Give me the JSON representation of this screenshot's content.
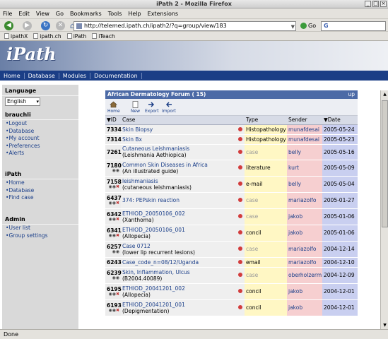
{
  "window": {
    "title": "iPath 2 - Mozilla Firefox"
  },
  "menu": [
    "File",
    "Edit",
    "View",
    "Go",
    "Bookmarks",
    "Tools",
    "Help",
    "Extensions"
  ],
  "address": {
    "url": "http://telemed.ipath.ch/ipath2/?q=group/view/183",
    "go_label": "Go",
    "search_value": "G"
  },
  "bookmarks": [
    "ipathX",
    "ipath.ch",
    "iPath",
    "iTeach"
  ],
  "site": {
    "logo": "iPath",
    "nav": [
      "Home",
      "Database",
      "Modules",
      "Documentation"
    ]
  },
  "sidebar": {
    "language_label": "Language",
    "language_value": "English",
    "user_heading": "brauchli",
    "user_items": [
      "Logout",
      "Database",
      "My account",
      "Preferences",
      "Alerts"
    ],
    "ipath_heading": "iPath",
    "ipath_items": [
      "Home",
      "Database",
      "Find case"
    ],
    "admin_heading": "Admin",
    "admin_items": [
      "User list",
      "Group settings"
    ]
  },
  "forum": {
    "title": "African Dermatology Forum ( 15)",
    "up_label": "up",
    "toolbar": [
      "Home",
      "New",
      "Export",
      "Import"
    ],
    "columns": [
      "ID",
      "Case",
      "Type",
      "Sender",
      "Date"
    ],
    "rows": [
      {
        "id": "7334",
        "case": "Skin Biopsy",
        "sub": "",
        "type": "Histopathology",
        "type_style": "normal",
        "sender": "munafdesai",
        "date": "2005-05-24",
        "icons": ""
      },
      {
        "id": "7314",
        "case": "Skin Bx",
        "sub": "",
        "type": "Histopathology",
        "type_style": "normal",
        "sender": "munafdesai",
        "date": "2005-05-23",
        "icons": ""
      },
      {
        "id": "7261",
        "case": "Cutaneous Leishmaniasis",
        "sub": "(Leishmania Aethiopica)",
        "type": "case",
        "type_style": "grey",
        "sender": "belly",
        "date": "2005-05-16",
        "icons": ""
      },
      {
        "id": "7180",
        "case": "Common Skin Diseases in Africa",
        "sub": "(An illustrated guide)",
        "type": "literature",
        "type_style": "normal",
        "sender": "kurt",
        "date": "2005-05-09",
        "icons": "spec"
      },
      {
        "id": "7158",
        "case": "leishmaniasis",
        "sub": "(cutaneous leishmaniasis)",
        "type": "e-mail",
        "type_style": "normal",
        "sender": "belly",
        "date": "2005-05-04",
        "icons": "specx"
      },
      {
        "id": "6437",
        "case": "374: PEPskin reaction",
        "sub": "",
        "type": "case",
        "type_style": "grey",
        "sender": "mariazolfo",
        "date": "2005-01-27",
        "icons": "specx"
      },
      {
        "id": "6342",
        "case": "ETHIOD_20050106_002",
        "sub": "(Xanthoma)",
        "type": "case",
        "type_style": "grey",
        "sender": "jakob",
        "date": "2005-01-06",
        "icons": "specx"
      },
      {
        "id": "6341",
        "case": "ETHIOD_20050106_001",
        "sub": "(Allopecia)",
        "type": "concil",
        "type_style": "normal",
        "sender": "jakob",
        "date": "2005-01-06",
        "icons": "specx"
      },
      {
        "id": "6257",
        "case": "Case 0712",
        "sub": "(lower lip recurrent lesions)",
        "type": "case",
        "type_style": "grey",
        "sender": "mariazolfo",
        "date": "2004-12-14",
        "icons": "spec"
      },
      {
        "id": "6243",
        "case": "Case_code_n=08/12/Uganda",
        "sub": "",
        "type": "email",
        "type_style": "normal",
        "sender": "mariazolfo",
        "date": "2004-12-10",
        "icons": ""
      },
      {
        "id": "6239",
        "case": "Skin, Inflammation, Ulcus",
        "sub": "(B2004.40089)",
        "type": "case",
        "type_style": "grey",
        "sender": "oberholzerm",
        "date": "2004-12-09",
        "icons": "spec"
      },
      {
        "id": "6195",
        "case": "ETHIOD_20041201_002",
        "sub": "(Allopecia)",
        "type": "concil",
        "type_style": "normal",
        "sender": "jakob",
        "date": "2004-12-01",
        "icons": "specx"
      },
      {
        "id": "6193",
        "case": "ETHIOD_20041201_001",
        "sub": "(Depigmentation)",
        "type": "concil",
        "type_style": "normal",
        "sender": "jakob",
        "date": "2004-12-01",
        "icons": "specx"
      }
    ]
  },
  "status": "Done",
  "colors": {
    "nav_blue": "#1b3e86",
    "forum_header": "#4c6aa6",
    "type_col": "#fff7c4",
    "sender_col": "#f6cfd0",
    "date_col": "#c9cff0"
  }
}
